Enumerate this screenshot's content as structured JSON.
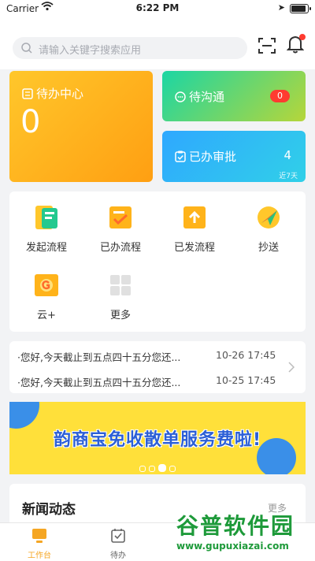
{
  "status_bar": {
    "carrier": "Carrier",
    "time": "6:22 PM"
  },
  "search": {
    "placeholder": "请输入关键字搜索应用"
  },
  "cards": {
    "todo": {
      "title": "待办中心",
      "count": "0",
      "color_from": "#ffc72b",
      "color_to": "#ff9f12"
    },
    "communication": {
      "title": "待沟通",
      "badge": "0",
      "color_from": "#1bd6a4",
      "color_to": "#b6d63a"
    },
    "approved": {
      "title": "已办审批",
      "count": "4",
      "subtitle": "近7天",
      "color_from": "#2fa8ff",
      "color_to": "#30d0e8"
    }
  },
  "apps": [
    {
      "label": "发起流程",
      "icon": "start-process-icon"
    },
    {
      "label": "已办流程",
      "icon": "done-process-icon"
    },
    {
      "label": "已发流程",
      "icon": "sent-process-icon"
    },
    {
      "label": "抄送",
      "icon": "cc-icon"
    },
    {
      "label": "云+",
      "icon": "cloud-plus-icon"
    },
    {
      "label": "更多",
      "icon": "more-grid-icon"
    }
  ],
  "notices": [
    {
      "text": "·您好,今天截止到五点四十五分您还...",
      "date": "10-26 17:45"
    },
    {
      "text": "·您好,今天截止到五点四十五分您还...",
      "date": "10-25 17:45"
    }
  ],
  "banner": {
    "text": "韵商宝免收散单服务费啦!"
  },
  "news": {
    "title": "新闻动态",
    "more": "更多"
  },
  "tabs": [
    {
      "label": "工作台",
      "active": true
    },
    {
      "label": "待办",
      "active": false
    }
  ],
  "watermark": {
    "main": "谷普软件园",
    "url": "www.gupuxiazai.com"
  },
  "colors": {
    "accent": "#f5a623",
    "badge_red": "#ff3b30"
  }
}
